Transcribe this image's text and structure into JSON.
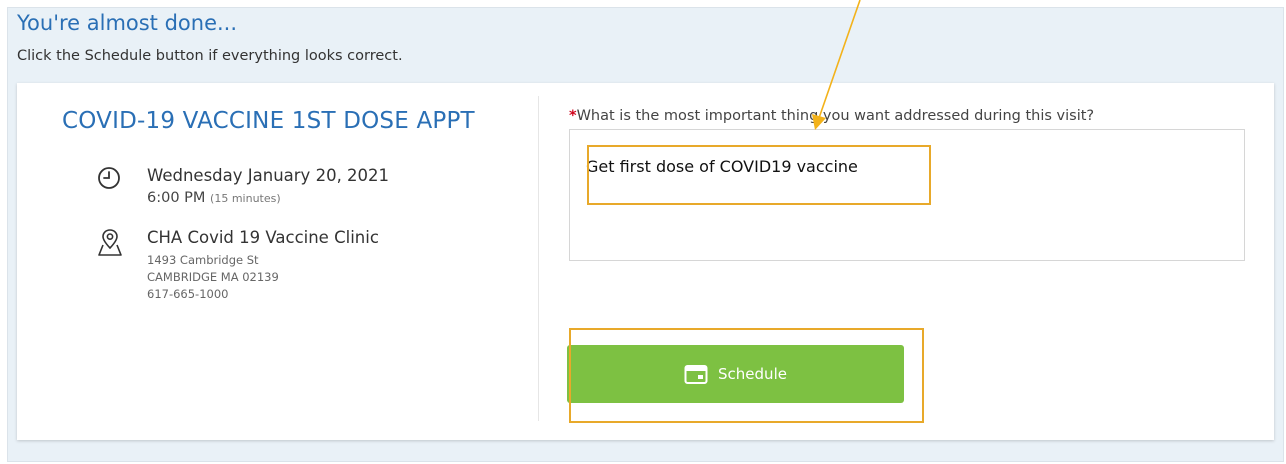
{
  "page": {
    "heading": "You're almost done...",
    "instruction": "Click the Schedule button if everything looks correct."
  },
  "appointment": {
    "title": "COVID-19 VACCINE 1ST DOSE APPT",
    "date": "Wednesday January 20, 2021",
    "time": "6:00 PM",
    "duration": "(15 minutes)",
    "location_name": "CHA Covid 19 Vaccine Clinic",
    "address_line1": "1493 Cambridge St",
    "address_line2": "CAMBRIDGE MA 02139",
    "phone": "617-665-1000"
  },
  "form": {
    "required_mark": "*",
    "question": "What is the most important thing you want addressed during this visit?",
    "answer": "Get first dose of COVID19 vaccine"
  },
  "button": {
    "schedule_label": "Schedule"
  },
  "annotations": {
    "highlight_color": "#e8a92a",
    "button_color": "#7dc142",
    "accent_color": "#2a6fb5"
  },
  "icons": {
    "time": "clock-icon",
    "location": "map-pin-icon",
    "schedule": "calendar-icon"
  }
}
